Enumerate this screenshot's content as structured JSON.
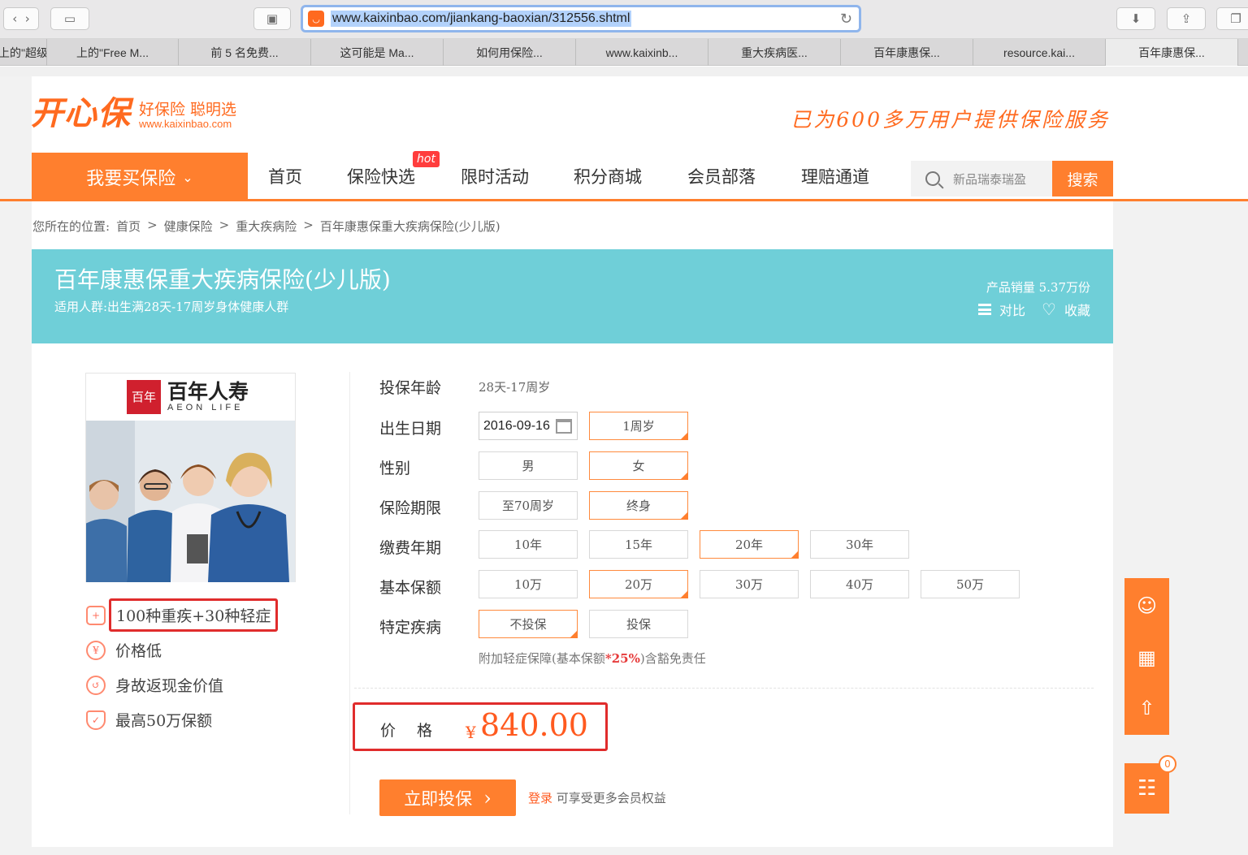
{
  "browser": {
    "url": "www.kaixinbao.com/jiankang-baoxian/312556.shtml",
    "tabs": [
      "上的\"超级",
      "上的\"Free M...",
      "前 5 名免费...",
      "这可能是 Ma...",
      "如何用保险...",
      "www.kaixinb...",
      "重大疾病医...",
      "百年康惠保...",
      "resource.kai...",
      "百年康惠保..."
    ]
  },
  "site": {
    "logo_text": "开心保",
    "logo_tagline": "好保险 聪明选",
    "logo_domain": "www.kaixinbao.com",
    "slogan": "已为600多万用户提供保险服务"
  },
  "nav": {
    "buy_label": "我要买保险",
    "items": [
      "首页",
      "保险快选",
      "限时活动",
      "积分商城",
      "会员部落",
      "理赔通道"
    ],
    "hot_badge": "hot",
    "search_placeholder": "新品瑞泰瑞盈",
    "search_button": "搜索"
  },
  "breadcrumb": [
    "您所在的位置:",
    "首页",
    ">",
    "健康保险",
    ">",
    "重大疾病险",
    ">",
    "百年康惠保重大疾病保险(少儿版)"
  ],
  "product": {
    "title": "百年康惠保重大疾病保险(少儿版)",
    "audience": "适用人群:出生满28天-17周岁身体健康人群",
    "sales": "产品销量 5.37万份",
    "compare_label": "对比",
    "favorite_label": "收藏",
    "insurer_name_cn": "百年人寿",
    "insurer_name_en": "AEON LIFE",
    "insurer_mark": "百年",
    "features": [
      {
        "icon": "medical-kit-icon",
        "text": "100种重疾+30种轻症"
      },
      {
        "icon": "yen-icon",
        "text": "价格低"
      },
      {
        "icon": "return-cash-icon",
        "text": "身故返现金价值"
      },
      {
        "icon": "shield-icon",
        "text": "最高50万保额"
      }
    ]
  },
  "options": {
    "age": {
      "label": "投保年龄",
      "value": "28天-17周岁"
    },
    "birthday": {
      "label": "出生日期",
      "value": "2016-09-16",
      "age_display": "1周岁"
    },
    "gender": {
      "label": "性别",
      "choices": [
        "男",
        "女"
      ],
      "selected": "女"
    },
    "term": {
      "label": "保险期限",
      "choices": [
        "至70周岁",
        "终身"
      ],
      "selected": "终身"
    },
    "pay_period": {
      "label": "缴费年期",
      "choices": [
        "10年",
        "15年",
        "20年",
        "30年"
      ],
      "selected": "20年"
    },
    "sum_insured": {
      "label": "基本保额",
      "choices": [
        "10万",
        "20万",
        "30万",
        "40万",
        "50万"
      ],
      "selected": "20万"
    },
    "special": {
      "label": "特定疾病",
      "choices": [
        "不投保",
        "投保"
      ],
      "selected": "不投保"
    },
    "note_pre": "附加轻症保障(基本保额",
    "note_pct": "*25%",
    "note_post": ")含豁免责任"
  },
  "price": {
    "label": "价格",
    "currency": "¥",
    "value": "840.00"
  },
  "cta": {
    "apply": "立即投保",
    "apply_arrow": "›",
    "login_link": "登录",
    "login_hint": "可享受更多会员权益"
  },
  "cart_count": "0",
  "colors": {
    "brand_orange": "#ff7f2e",
    "banner_teal": "#6fcfd8",
    "highlight_red": "#e02c2c",
    "price_orange": "#ff5a1f"
  }
}
